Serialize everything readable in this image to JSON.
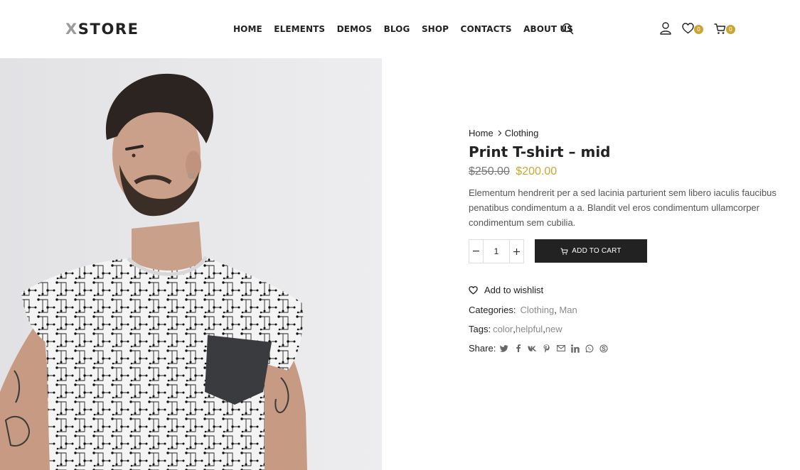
{
  "header": {
    "logo_x": "X",
    "logo_rest": "STORE",
    "nav": [
      "HOME",
      "ELEMENTS",
      "DEMOS",
      "BLOG",
      "SHOP",
      "CONTACTS",
      "ABOUT US"
    ],
    "wishlist_count": "0",
    "cart_count": "0"
  },
  "breadcrumb": [
    "Home",
    "Clothing"
  ],
  "product": {
    "title": "Print T-shirt – mid",
    "old_price": "$250.00",
    "new_price": "$200.00",
    "description": "Elementum hendrerit per a sed lacinia parturient sem libero iaculis faucibus penatibus condimentum a a. Blandit vel eros condimentum ullamcorper condimentum sem cubilia.",
    "quantity": "1",
    "add_to_cart_label": "ADD TO CART",
    "wishlist_label": "Add to wishlist"
  },
  "meta": {
    "categories_label": "Categories:",
    "categories": [
      "Clothing",
      "Man"
    ],
    "tags_label": "Tags:",
    "tags": [
      "color",
      "helpful",
      "new"
    ],
    "share_label": "Share:",
    "share_icons": [
      "twitter-icon",
      "facebook-icon",
      "vk-icon",
      "pinterest-icon",
      "email-icon",
      "linkedin-icon",
      "whatsapp-icon",
      "skype-icon"
    ]
  },
  "colors": {
    "accent": "#c9a634",
    "dark": "#222222",
    "muted": "#8a8a8a"
  }
}
